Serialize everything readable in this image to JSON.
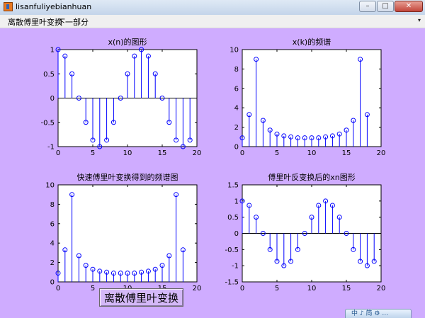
{
  "window": {
    "title": "lisanfuliyebianhuan",
    "min_glyph": "–",
    "max_glyph": "□",
    "close_glyph": "✕"
  },
  "menu": {
    "items": [
      "离散傅里叶变换",
      "下一部分"
    ],
    "overflow_glyph": "▾"
  },
  "button": {
    "label": "离散傅里叶变换"
  },
  "corner_tools": {
    "text": "中 ♪ 简 ⚙ …"
  },
  "colors": {
    "figure_bg": "#cfacff",
    "stem": "#0000ff",
    "axes_bg": "#ffffff"
  },
  "chart_data": [
    {
      "type": "stem",
      "title": "x(n)的图形",
      "xlim": [
        0,
        20
      ],
      "ylim": [
        -1,
        1
      ],
      "xticks": [
        0,
        5,
        10,
        15,
        20
      ],
      "yticks": [
        -1,
        -0.5,
        0,
        0.5,
        1
      ],
      "x": [
        0,
        1,
        2,
        3,
        4,
        5,
        6,
        7,
        8,
        9,
        10,
        11,
        12,
        13,
        14,
        15,
        16,
        17,
        18,
        19
      ],
      "y": [
        1,
        0.866,
        0.5,
        0,
        -0.5,
        -0.866,
        -1,
        -0.866,
        -0.5,
        0,
        0.5,
        0.866,
        1,
        0.866,
        0.5,
        0,
        -0.5,
        -0.866,
        -1,
        -0.866
      ]
    },
    {
      "type": "stem",
      "title": "x(k)的频谱",
      "xlim": [
        0,
        20
      ],
      "ylim": [
        0,
        10
      ],
      "xticks": [
        0,
        5,
        10,
        15,
        20
      ],
      "yticks": [
        0,
        2,
        4,
        6,
        8,
        10
      ],
      "x": [
        0,
        1,
        2,
        3,
        4,
        5,
        6,
        7,
        8,
        9,
        10,
        11,
        12,
        13,
        14,
        15,
        16,
        17,
        18,
        19
      ],
      "y": [
        0.9,
        3.3,
        9.0,
        2.7,
        1.7,
        1.3,
        1.1,
        1.0,
        0.9,
        0.9,
        0.9,
        0.9,
        1.0,
        1.1,
        1.3,
        1.7,
        2.7,
        9.0,
        3.3
      ]
    },
    {
      "type": "stem",
      "title": "快速傅里叶变换得到的频谱图",
      "xlim": [
        0,
        20
      ],
      "ylim": [
        0,
        10
      ],
      "xticks": [
        0,
        5,
        10,
        15,
        20
      ],
      "yticks": [
        0,
        2,
        4,
        6,
        8,
        10
      ],
      "x": [
        0,
        1,
        2,
        3,
        4,
        5,
        6,
        7,
        8,
        9,
        10,
        11,
        12,
        13,
        14,
        15,
        16,
        17,
        18,
        19
      ],
      "y": [
        0.9,
        3.3,
        9.0,
        2.7,
        1.7,
        1.3,
        1.1,
        1.0,
        0.9,
        0.9,
        0.9,
        0.9,
        1.0,
        1.1,
        1.3,
        1.7,
        2.7,
        9.0,
        3.3
      ]
    },
    {
      "type": "stem",
      "title": "傅里叶反变换后的xn图形",
      "xlim": [
        0,
        20
      ],
      "ylim": [
        -1.5,
        1.5
      ],
      "xticks": [
        0,
        5,
        10,
        15,
        20
      ],
      "yticks": [
        -1.5,
        -1,
        -0.5,
        0,
        0.5,
        1,
        1.5
      ],
      "x": [
        0,
        1,
        2,
        3,
        4,
        5,
        6,
        7,
        8,
        9,
        10,
        11,
        12,
        13,
        14,
        15,
        16,
        17,
        18,
        19
      ],
      "y": [
        1,
        0.866,
        0.5,
        0,
        -0.5,
        -0.866,
        -1,
        -0.866,
        -0.5,
        0,
        0.5,
        0.866,
        1,
        0.866,
        0.5,
        0,
        -0.5,
        -0.866,
        -1,
        -0.866
      ]
    }
  ]
}
